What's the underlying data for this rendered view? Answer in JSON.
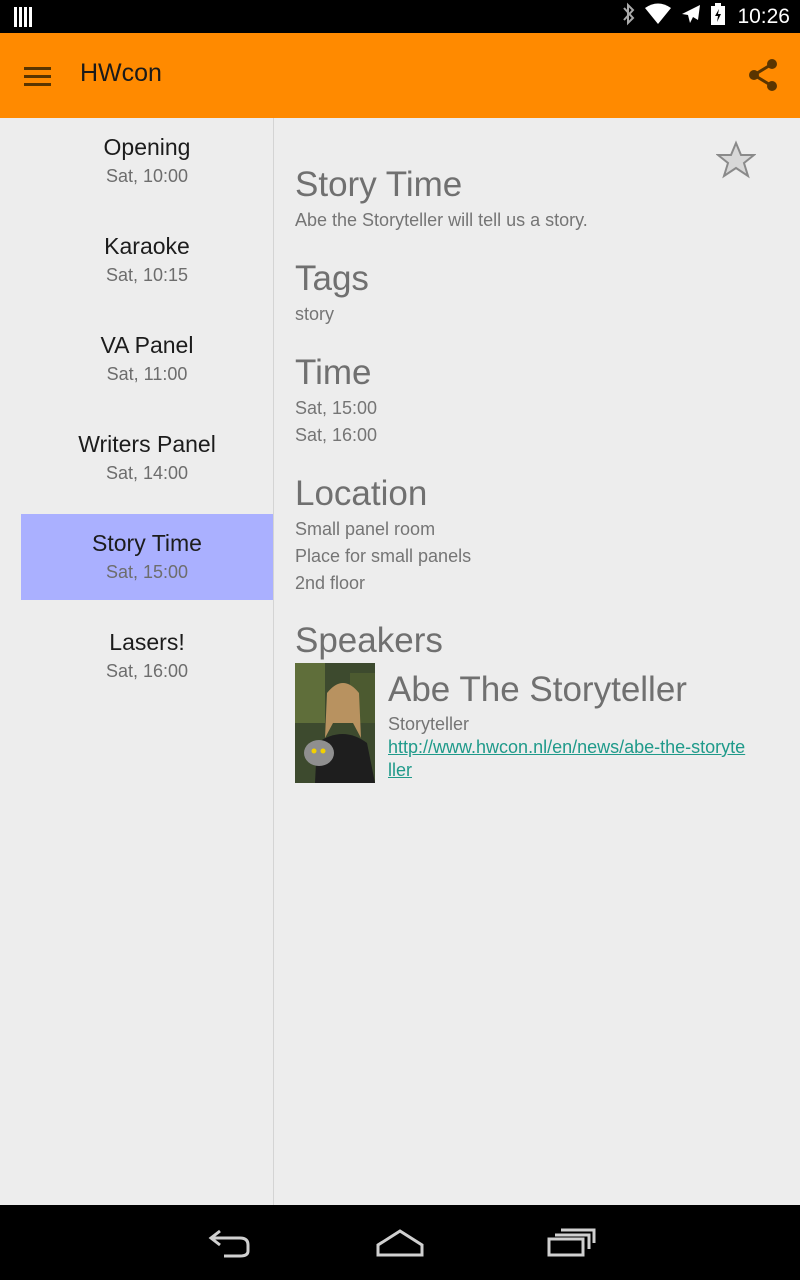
{
  "status": {
    "time": "10:26"
  },
  "app": {
    "title": "HWcon"
  },
  "events": [
    {
      "name": "Opening",
      "time": "Sat, 10:00",
      "selected": false
    },
    {
      "name": "Karaoke",
      "time": "Sat, 10:15",
      "selected": false
    },
    {
      "name": "VA Panel",
      "time": "Sat, 11:00",
      "selected": false
    },
    {
      "name": "Writers Panel",
      "time": "Sat, 14:00",
      "selected": false
    },
    {
      "name": "Story Time",
      "time": "Sat, 15:00",
      "selected": true
    },
    {
      "name": "Lasers!",
      "time": "Sat, 16:00",
      "selected": false
    }
  ],
  "detail": {
    "title": "Story Time",
    "description": "Abe the Storyteller will tell us a story.",
    "tags_heading": "Tags",
    "tags": "story",
    "time_heading": "Time",
    "start": "Sat, 15:00",
    "end": "Sat, 16:00",
    "location_heading": "Location",
    "location_name": "Small panel room",
    "location_desc": "Place for small panels",
    "location_floor": "2nd floor",
    "speakers_heading": "Speakers",
    "speaker": {
      "name": "Abe The Storyteller",
      "role": "Storyteller",
      "link": "http://www.hwcon.nl/en/news/abe-the-storyteller"
    }
  },
  "colors": {
    "app_bar": "#ff8a00",
    "selected": "#aab0ff",
    "link": "#1f9a8a"
  },
  "icons": [
    "notification-icon",
    "bluetooth-icon",
    "wifi-icon",
    "airplane-icon",
    "battery-icon",
    "menu-icon",
    "share-icon",
    "star-icon",
    "back-icon",
    "home-icon",
    "recents-icon"
  ]
}
